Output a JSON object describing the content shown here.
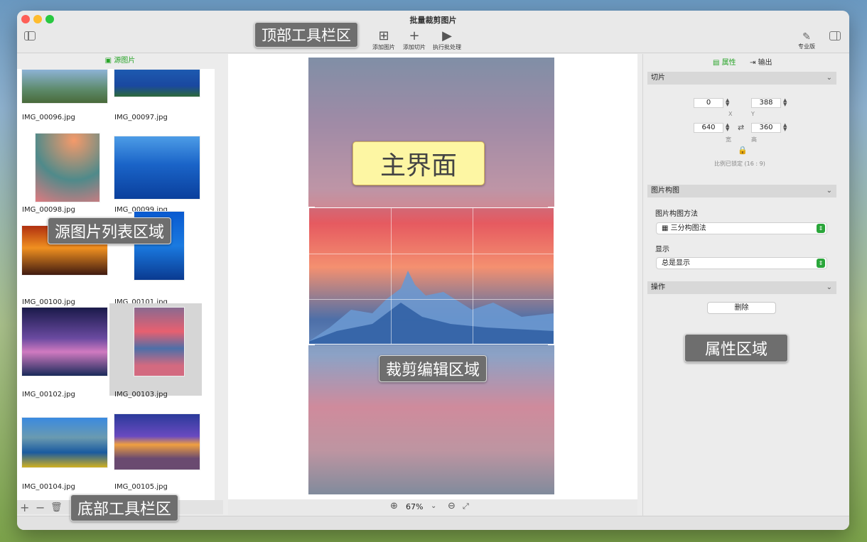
{
  "window": {
    "title": "批量裁剪图片"
  },
  "toolbar": {
    "add_image": "添加图片",
    "add_slice": "添加切片",
    "run_batch": "执行批处理",
    "pro": "专业版"
  },
  "annotations": {
    "top_toolbar": "顶部工具栏区",
    "source_list": "源图片列表区域",
    "bottom_toolbar": "底部工具栏区",
    "main_ui": "主界面",
    "crop_area": "裁剪编辑区域",
    "properties": "属性区域"
  },
  "left": {
    "tab": "源图片",
    "files": [
      "IMG_00096.jpg",
      "IMG_00097.jpg",
      "IMG_00098.jpg",
      "IMG_00099.jpg",
      "IMG_00100.jpg",
      "IMG_00101.jpg",
      "IMG_00102.jpg",
      "IMG_00103.jpg",
      "IMG_00104.jpg",
      "IMG_00105.jpg"
    ],
    "selected": "IMG_00103.jpg"
  },
  "zoom": {
    "value": "67%"
  },
  "right": {
    "tab_props": "属性",
    "tab_output": "输出",
    "slice": {
      "header": "切片",
      "x": "0",
      "y": "388",
      "w": "640",
      "h": "360",
      "x_label": "X",
      "y_label": "Y",
      "w_label": "宽",
      "h_label": "高",
      "ratio": "比例已锁定 (16 : 9)"
    },
    "composition": {
      "header": "图片构图",
      "method_label": "图片构图方法",
      "method": "三分构图法",
      "show_label": "显示",
      "show": "总是显示"
    },
    "ops": {
      "header": "操作",
      "delete": "删除"
    }
  },
  "colors": {
    "accent": "#28a428"
  }
}
